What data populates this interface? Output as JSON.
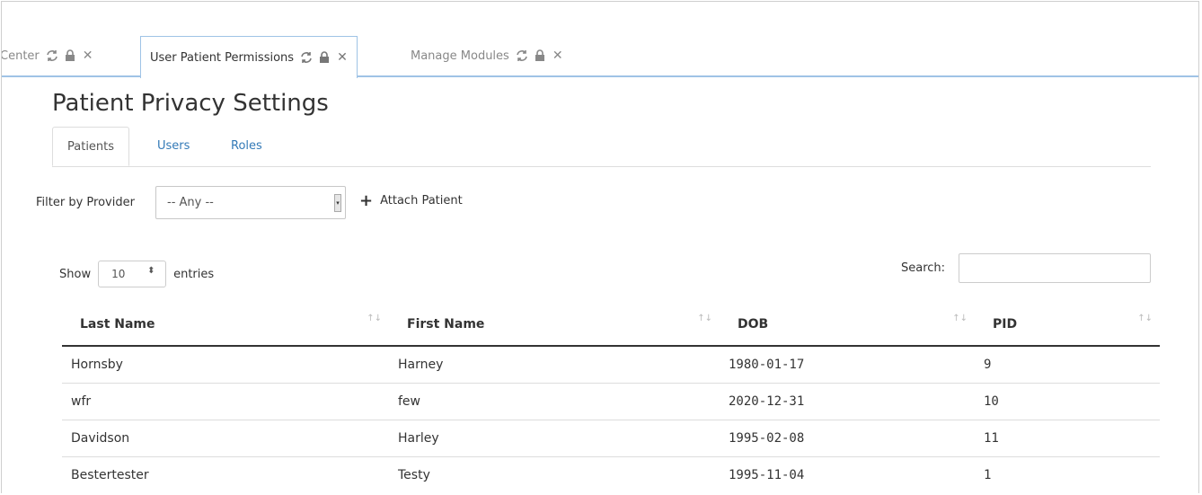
{
  "tabs": [
    {
      "label": "Center",
      "active": false
    },
    {
      "label": "User Patient Permissions",
      "active": true
    },
    {
      "label": "Manage Modules",
      "active": false
    }
  ],
  "page": {
    "title": "Patient Privacy Settings"
  },
  "subtabs": [
    {
      "label": "Patients",
      "active": true
    },
    {
      "label": "Users",
      "active": false
    },
    {
      "label": "Roles",
      "active": false
    }
  ],
  "filter": {
    "label": "Filter by Provider",
    "selected": "-- Any --",
    "attach_label": "Attach Patient"
  },
  "length": {
    "show_label": "Show",
    "value": "10",
    "entries_label": "entries"
  },
  "search": {
    "label": "Search:",
    "value": ""
  },
  "table": {
    "headers": [
      "Last Name",
      "First Name",
      "DOB",
      "PID"
    ],
    "rows": [
      [
        "Hornsby",
        "Harney",
        "1980-01-17",
        "9"
      ],
      [
        "wfr",
        "few",
        "2020-12-31",
        "10"
      ],
      [
        "Davidson",
        "Harley",
        "1995-02-08",
        "11"
      ],
      [
        "Bestertester",
        "Testy",
        "1995-11-04",
        "1"
      ]
    ]
  },
  "colors": {
    "accent": "#337ab7",
    "tab_border": "#9fc3e6"
  }
}
